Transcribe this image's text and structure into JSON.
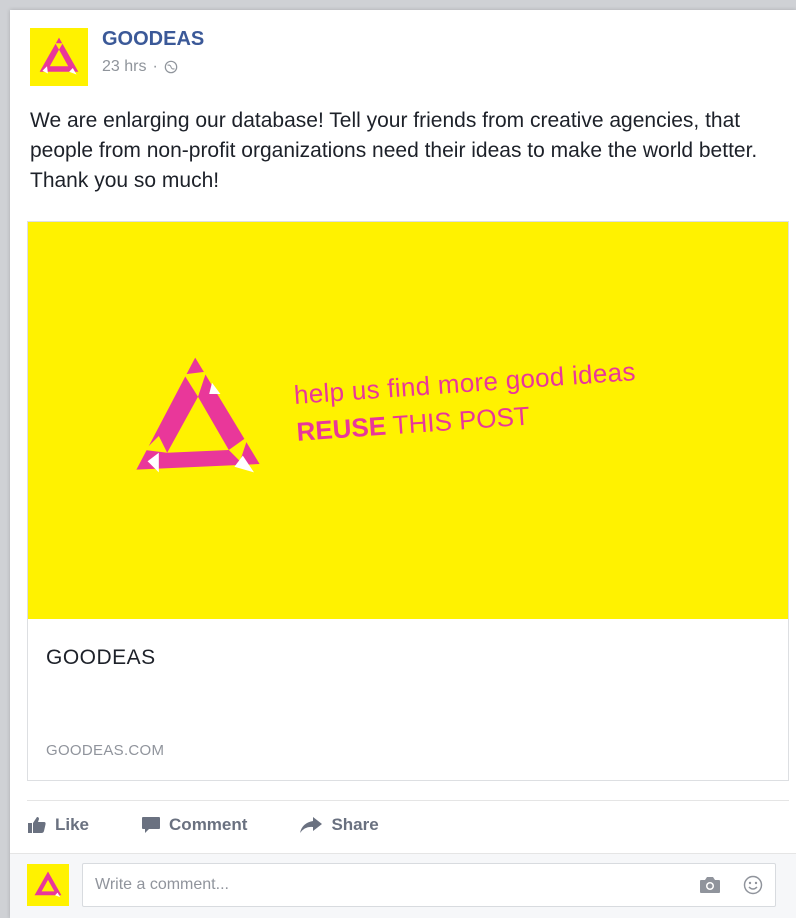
{
  "post": {
    "page_name": "GOODEAS",
    "timestamp": "23 hrs",
    "separator": "·",
    "privacy_icon": "globe-icon",
    "text": "We are enlarging our database! Tell your friends from creative agencies, that people from non-profit organizations need their ideas to make the world better.  Thank you so much!"
  },
  "link_preview": {
    "banner_line1": "help us find more good ideas",
    "banner_line2_bold": "REUSE",
    "banner_line2_rest": " THIS POST",
    "title": "GOODEAS",
    "domain": "GOODEAS.COM",
    "colors": {
      "background": "#fff200",
      "accent": "#e9379a"
    }
  },
  "actions": {
    "like": "Like",
    "comment": "Comment",
    "share": "Share"
  },
  "comment_box": {
    "placeholder": "Write a comment...",
    "icons": [
      "camera-icon",
      "emoji-icon"
    ]
  },
  "colors": {
    "brand_blue": "#3b5998",
    "text": "#1d2129",
    "muted": "#90949c"
  }
}
